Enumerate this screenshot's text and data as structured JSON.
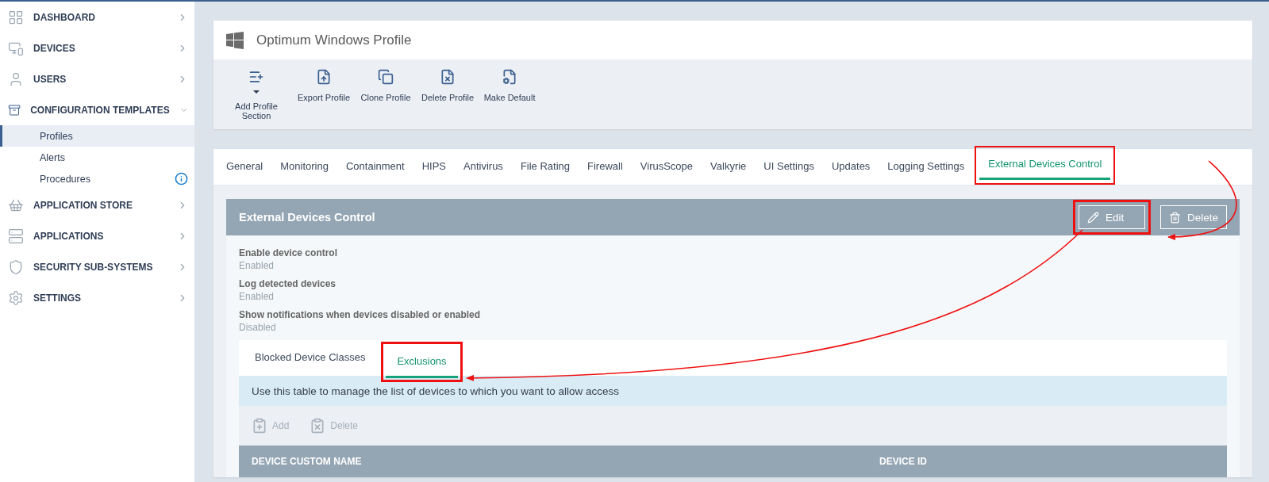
{
  "sidebar": {
    "items": [
      {
        "label": "DASHBOARD",
        "expanded": false
      },
      {
        "label": "DEVICES",
        "expanded": false
      },
      {
        "label": "USERS",
        "expanded": false
      },
      {
        "label": "CONFIGURATION TEMPLATES",
        "expanded": true,
        "children": [
          {
            "label": "Profiles",
            "selected": true,
            "info_badge": false
          },
          {
            "label": "Alerts",
            "selected": false,
            "info_badge": false
          },
          {
            "label": "Procedures",
            "selected": false,
            "info_badge": true
          }
        ]
      },
      {
        "label": "APPLICATION STORE",
        "expanded": false
      },
      {
        "label": "APPLICATIONS",
        "expanded": false
      },
      {
        "label": "SECURITY SUB-SYSTEMS",
        "expanded": false
      },
      {
        "label": "SETTINGS",
        "expanded": false
      }
    ]
  },
  "profile": {
    "title": "Optimum Windows Profile",
    "actions": [
      {
        "label": "Add Profile Section",
        "kind": "dropdown"
      },
      {
        "label": "Export Profile",
        "kind": "button"
      },
      {
        "label": "Clone Profile",
        "kind": "button"
      },
      {
        "label": "Delete Profile",
        "kind": "button"
      },
      {
        "label": "Make Default",
        "kind": "button"
      }
    ]
  },
  "tabs": [
    {
      "label": "General",
      "selected": false,
      "highlighted": false
    },
    {
      "label": "Monitoring",
      "selected": false,
      "highlighted": false
    },
    {
      "label": "Containment",
      "selected": false,
      "highlighted": false
    },
    {
      "label": "HIPS",
      "selected": false,
      "highlighted": false
    },
    {
      "label": "Antivirus",
      "selected": false,
      "highlighted": false
    },
    {
      "label": "File Rating",
      "selected": false,
      "highlighted": false
    },
    {
      "label": "Firewall",
      "selected": false,
      "highlighted": false
    },
    {
      "label": "VirusScope",
      "selected": false,
      "highlighted": false
    },
    {
      "label": "Valkyrie",
      "selected": false,
      "highlighted": false
    },
    {
      "label": "UI Settings",
      "selected": false,
      "highlighted": false
    },
    {
      "label": "Updates",
      "selected": false,
      "highlighted": false
    },
    {
      "label": "Logging Settings",
      "selected": false,
      "highlighted": false
    },
    {
      "label": "External Devices Control",
      "selected": true,
      "highlighted": true
    }
  ],
  "section": {
    "title": "External Devices Control",
    "buttons": [
      {
        "label": "Edit",
        "highlighted": true
      },
      {
        "label": "Delete",
        "highlighted": false
      }
    ],
    "settings": [
      {
        "label": "Enable device control",
        "value": "Enabled"
      },
      {
        "label": "Log detected devices",
        "value": "Enabled"
      },
      {
        "label": "Show notifications when devices disabled or enabled",
        "value": "Disabled"
      }
    ],
    "subtabs": [
      {
        "label": "Blocked Device Classes",
        "selected": false,
        "highlighted": false
      },
      {
        "label": "Exclusions",
        "selected": true,
        "highlighted": true
      }
    ],
    "info": "Use this table to manage the list of devices to which you want to allow access",
    "table_actions": [
      {
        "label": "Add",
        "disabled": true
      },
      {
        "label": "Delete",
        "disabled": true
      }
    ],
    "table": {
      "columns": [
        "DEVICE CUSTOM NAME",
        "DEVICE ID"
      ]
    }
  }
}
